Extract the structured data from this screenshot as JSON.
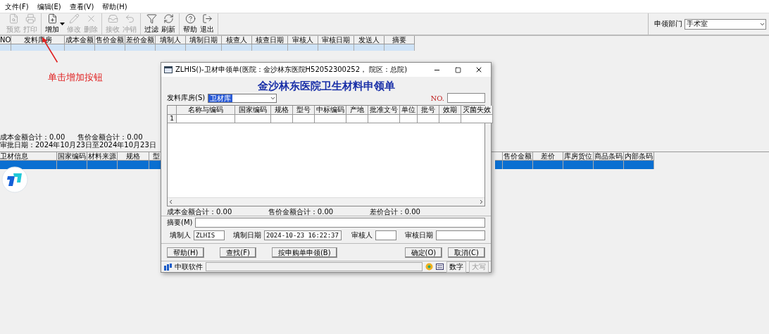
{
  "menu": [
    {
      "label": "文件(F)"
    },
    {
      "label": "编辑(E)"
    },
    {
      "label": "查看(V)"
    },
    {
      "label": "帮助(H)"
    }
  ],
  "toolbar": [
    {
      "label": "预览",
      "kind": "button",
      "disabled": true
    },
    {
      "label": "打印",
      "kind": "button",
      "disabled": true
    },
    {
      "label": "增加",
      "kind": "split",
      "disabled": false
    },
    {
      "label": "修改",
      "kind": "button",
      "disabled": true
    },
    {
      "label": "删除",
      "kind": "button",
      "disabled": true
    },
    {
      "label": "接收",
      "kind": "button",
      "disabled": true
    },
    {
      "label": "冲销",
      "kind": "button",
      "disabled": true
    },
    {
      "label": "过滤",
      "kind": "button",
      "disabled": false
    },
    {
      "label": "刷新",
      "kind": "button",
      "disabled": false
    },
    {
      "label": "帮助",
      "kind": "button",
      "disabled": false
    },
    {
      "label": "退出",
      "kind": "button",
      "disabled": false
    }
  ],
  "department": {
    "label": "申领部门",
    "value": "手术室"
  },
  "top_grid": {
    "columns": [
      "NO",
      "发料库房",
      "成本金额",
      "售价金额",
      "差价金额",
      "填制人",
      "填制日期",
      "核查人",
      "核查日期",
      "审核人",
      "审核日期",
      "发送人",
      "摘要"
    ],
    "rows": [
      {
        "selected": true
      }
    ]
  },
  "annotation": {
    "text": "单击增加按钮"
  },
  "summary": {
    "totals": [
      "成本金额合计：0.00",
      "售价金额合计：0.00"
    ],
    "date_range": "审批日期：2024年10月23日至2024年10月23日"
  },
  "bottom_grid": {
    "columns_left": [
      "卫材信息",
      "国家编码",
      "材料来源",
      "规格",
      "型"
    ],
    "columns_right": [
      "售价金额",
      "差价",
      "库房货位",
      "商品条码",
      "内部条码"
    ],
    "rows": [
      {
        "selected": true
      }
    ]
  },
  "dialog": {
    "title": "ZLHIS()-卫材申领单(医院：金沙林东医院H52052300252， 院区：总院)",
    "heading": "金沙林东医院卫生材料申领单",
    "store": {
      "label": "发料库房(S)",
      "value": "卫材库",
      "highlighted": true
    },
    "number": {
      "label": "NO."
    },
    "columns": [
      "",
      "名称与编码",
      "国家编码",
      "规格",
      "型号",
      "中标编码",
      "产地",
      "批准文号",
      "单位",
      "批号",
      "效期",
      "灭菌失效"
    ],
    "rows": [
      {
        "number": "1"
      }
    ],
    "totals": [
      "成本金额合计：0.00",
      "售价金额合计：0.00",
      "差价合计：0.00"
    ],
    "memo": {
      "label": "摘要(M)"
    },
    "fields": [
      {
        "label": "填制人",
        "value": "ZLHIS"
      },
      {
        "label": "填制日期",
        "value": "2024-10-23 16:22:37"
      },
      {
        "label": "审核人"
      },
      {
        "label": "审核日期"
      }
    ],
    "buttons_left": [
      "帮助(H)",
      "查找(F)",
      "按申购单申领(B)"
    ],
    "buttons_right": [
      "确定(O)",
      "取消(C)"
    ],
    "status": {
      "brand": "中联软件",
      "indicators": [
        {
          "text": "数字",
          "on": true
        },
        {
          "text": "大写",
          "on": false
        }
      ]
    }
  }
}
